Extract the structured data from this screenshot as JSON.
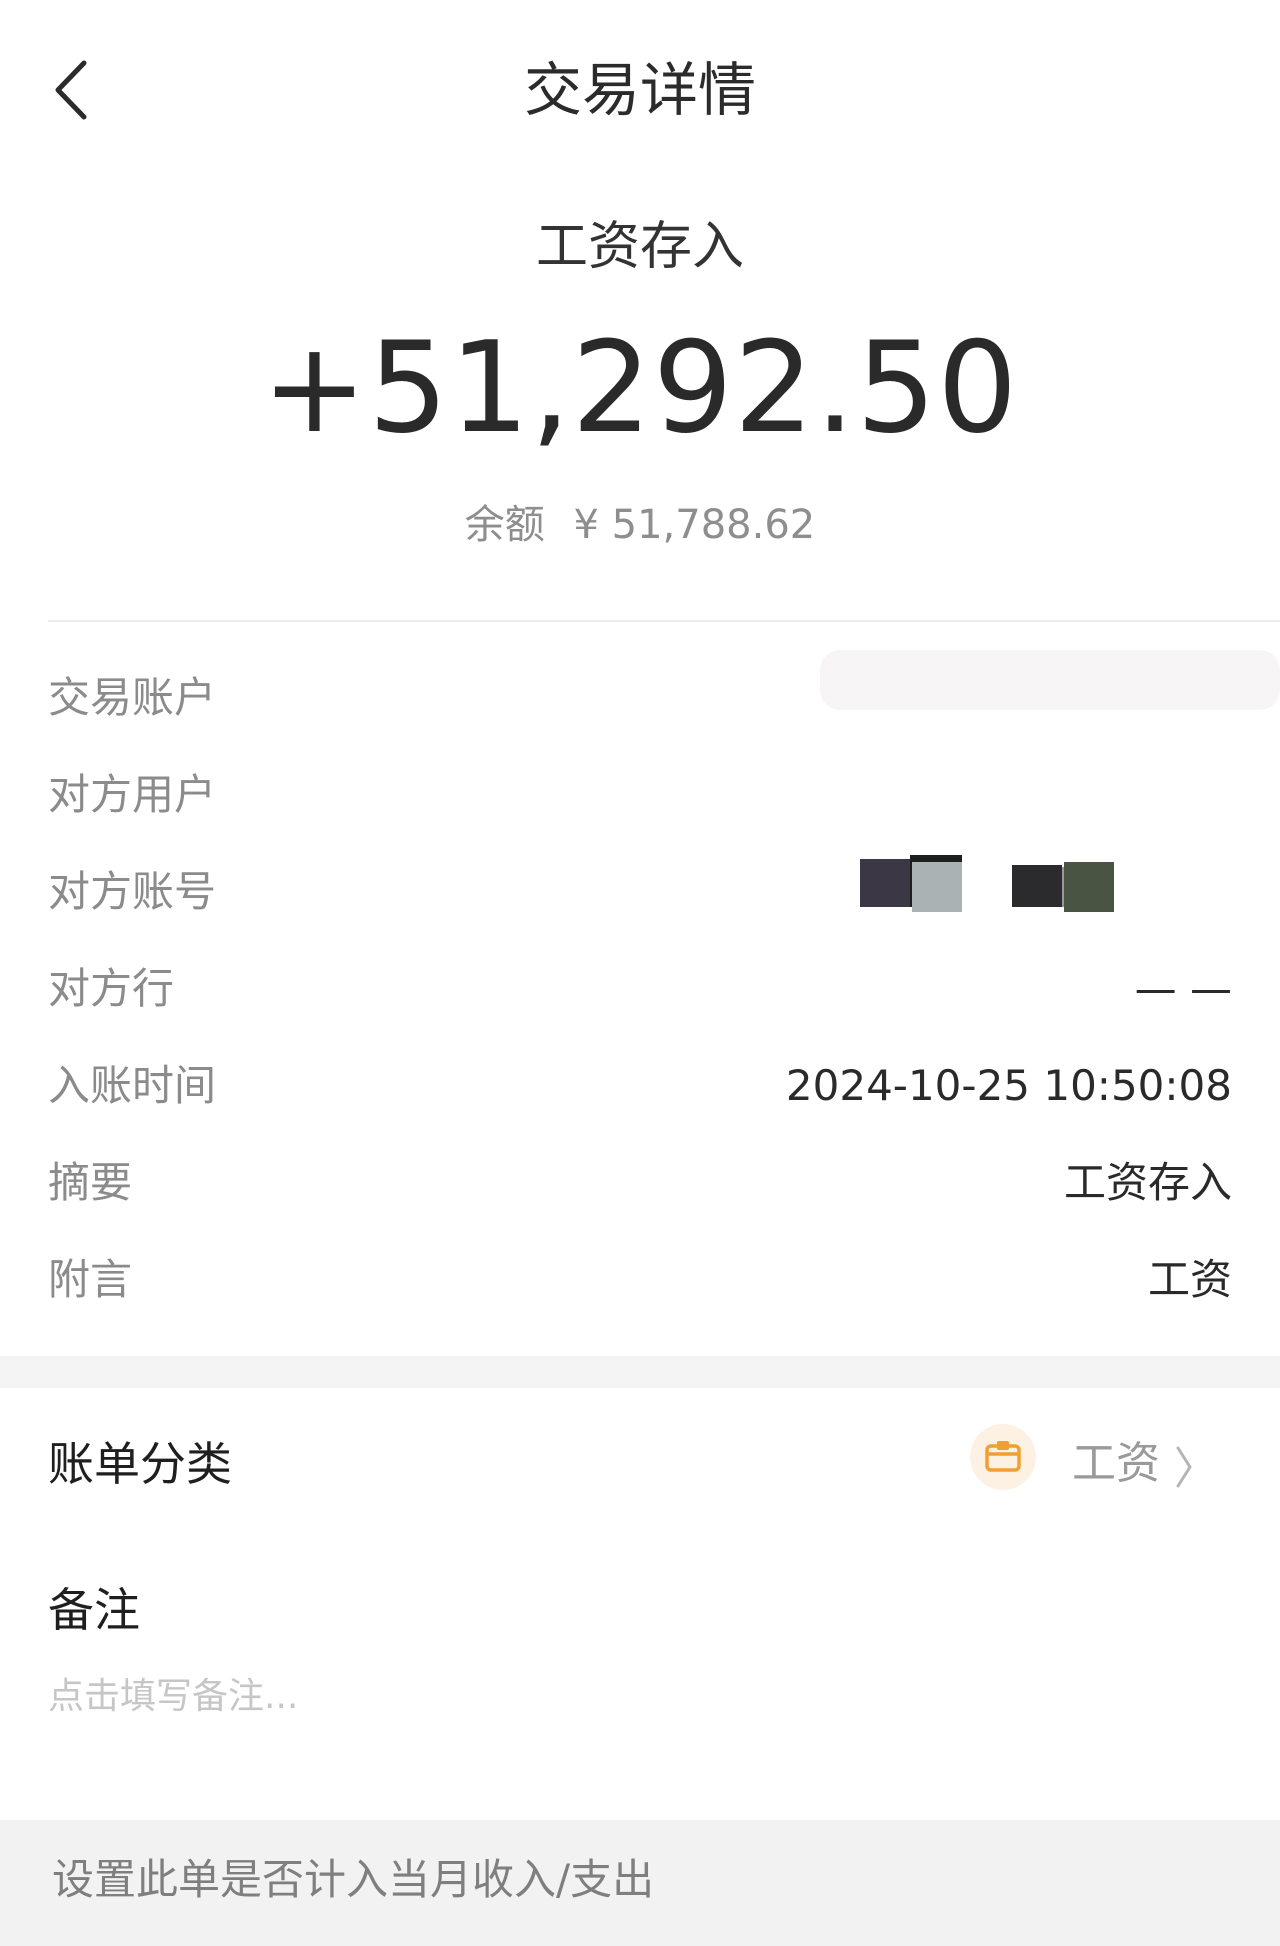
{
  "header": {
    "title": "交易详情"
  },
  "summary": {
    "type": "工资存入",
    "amount": "+51,292.50",
    "balance_label": "余额",
    "balance_value": "¥ 51,788.62"
  },
  "details": [
    {
      "label": "交易账户",
      "value": ""
    },
    {
      "label": "对方用户",
      "value": ""
    },
    {
      "label": "对方账号",
      "value": ""
    },
    {
      "label": "对方行",
      "value": "— —"
    },
    {
      "label": "入账时间",
      "value": "2024-10-25 10:50:08"
    },
    {
      "label": "摘要",
      "value": "工资存入"
    },
    {
      "label": "附言",
      "value": "工资"
    }
  ],
  "category": {
    "label": "账单分类",
    "value": "工资",
    "icon": "wallet-icon"
  },
  "note": {
    "title": "备注",
    "placeholder": "点击填写备注..."
  },
  "footer": {
    "text": "设置此单是否计入当月收入/支出"
  },
  "colors": {
    "accent": "#f0a030",
    "label_gray": "#8b8b8b",
    "text_dark": "#2a2a2a"
  }
}
